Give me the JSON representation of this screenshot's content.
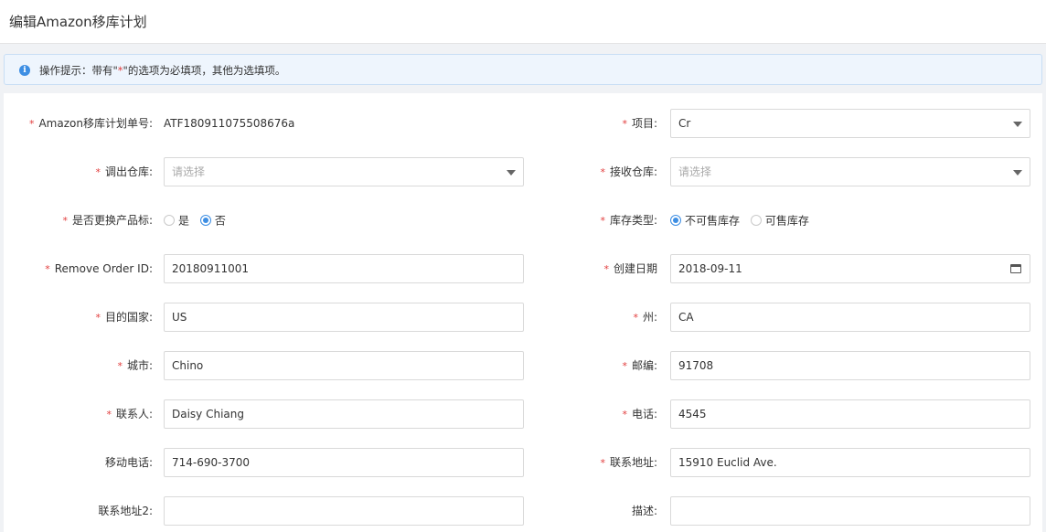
{
  "header": {
    "title": "编辑Amazon移库计划"
  },
  "notice": {
    "icon": "info-icon",
    "prefix": "操作提示：带有\"",
    "star": "*",
    "suffix": "\"的选项为必填项，其他为选填项。"
  },
  "form": {
    "required_mark": "*",
    "plan_no": {
      "label": "Amazon移库计划单号:",
      "value": "ATF180911075508676a"
    },
    "project": {
      "label": "项目:",
      "value": "Cr"
    },
    "out_warehouse": {
      "label": "调出仓库:",
      "placeholder": "请选择"
    },
    "in_warehouse": {
      "label": "接收仓库:",
      "placeholder": "请选择"
    },
    "replace_label": {
      "label": "是否更换产品标:",
      "options": [
        "是",
        "否"
      ],
      "selected": "否"
    },
    "inventory_type": {
      "label": "库存类型:",
      "options": [
        "不可售库存",
        "可售库存"
      ],
      "selected": "不可售库存"
    },
    "remove_order_id": {
      "label": "Remove Order ID:",
      "value": "20180911001"
    },
    "create_date": {
      "label": "创建日期",
      "value": "2018-09-11"
    },
    "country": {
      "label": "目的国家:",
      "value": "US"
    },
    "state": {
      "label": "州:",
      "value": "CA"
    },
    "city": {
      "label": "城市:",
      "value": "Chino"
    },
    "zip": {
      "label": "邮编:",
      "value": "91708"
    },
    "contact": {
      "label": "联系人:",
      "value": "Daisy Chiang"
    },
    "phone": {
      "label": "电话:",
      "value": "4545"
    },
    "mobile": {
      "label": "移动电话:",
      "value": "714-690-3700"
    },
    "address": {
      "label": "联系地址:",
      "value": "15910 Euclid Ave."
    },
    "address2": {
      "label": "联系地址2:",
      "value": ""
    },
    "description": {
      "label": "描述:",
      "value": ""
    }
  },
  "colors": {
    "accent": "#3d8ee3",
    "required": "#e23c3c",
    "notice_bg": "#eef5fd"
  }
}
